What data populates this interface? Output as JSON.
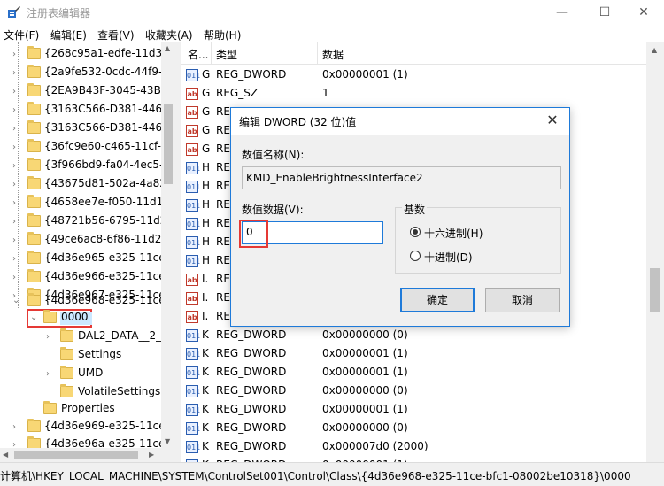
{
  "window": {
    "title": "注册表编辑器",
    "minimize": "—",
    "maximize": "☐",
    "close": "✕"
  },
  "menu": [
    "文件(F)",
    "编辑(E)",
    "查看(V)",
    "收藏夹(A)",
    "帮助(H)"
  ],
  "tree": {
    "keys": [
      "{268c95a1-edfe-11d3-9",
      "{2a9fe532-0cdc-44f9-9",
      "{2EA9B43F-3045-43B5-",
      "{3163C566-D381-4467-",
      "{3163C566-D381-4467-",
      "{36fc9e60-c465-11cf-80",
      "{3f966bd9-fa04-4ec5-9",
      "{43675d81-502a-4a82-",
      "{4658ee7e-f050-11d1-b",
      "{48721b56-6795-11d2-",
      "{49ce6ac8-6f86-11d2-b",
      "{4d36e965-e325-11ce-",
      "{4d36e966-e325-11ce-",
      "{4d36e967-e325-11ce-",
      "{4d36e968-e325-11ce-"
    ],
    "selected": "0000",
    "children": [
      "DAL2_DATA__2_0",
      "Settings",
      "UMD",
      "VolatileSettings"
    ],
    "properties": "Properties",
    "after": [
      "{4d36e969-e325-11ce-",
      "{4d36e96a-e325-11ce-"
    ]
  },
  "list": {
    "headers": {
      "name": "名...",
      "type": "类型",
      "data": "数据"
    },
    "rows": [
      {
        "icon": "bin",
        "name": "G",
        "type": "REG_DWORD",
        "data": "0x00000001 (1)"
      },
      {
        "icon": "ab",
        "name": "G",
        "type": "REG_SZ",
        "data": "1"
      },
      {
        "icon": "ab",
        "name": "G",
        "type": "RE",
        "data": ""
      },
      {
        "icon": "ab",
        "name": "G",
        "type": "RE",
        "data": ""
      },
      {
        "icon": "ab",
        "name": "G",
        "type": "RE",
        "data": ""
      },
      {
        "icon": "bin",
        "name": "H",
        "type": "RE",
        "data": ""
      },
      {
        "icon": "bin",
        "name": "H",
        "type": "RE",
        "data": ""
      },
      {
        "icon": "bin",
        "name": "H",
        "type": "RE",
        "data": ""
      },
      {
        "icon": "bin",
        "name": "H",
        "type": "RE",
        "data": ""
      },
      {
        "icon": "bin",
        "name": "H",
        "type": "RE",
        "data": ""
      },
      {
        "icon": "bin",
        "name": "H",
        "type": "RE",
        "data": ""
      },
      {
        "icon": "ab",
        "name": "I.",
        "type": "RE",
        "data": ""
      },
      {
        "icon": "ab",
        "name": "I.",
        "type": "RE",
        "data": ""
      },
      {
        "icon": "ab",
        "name": "I.",
        "type": "RE",
        "data": ""
      },
      {
        "icon": "bin",
        "name": "K",
        "type": "REG_DWORD",
        "data": "0x00000000 (0)"
      },
      {
        "icon": "bin",
        "name": "K",
        "type": "REG_DWORD",
        "data": "0x00000001 (1)"
      },
      {
        "icon": "bin",
        "name": "K",
        "type": "REG_DWORD",
        "data": "0x00000001 (1)"
      },
      {
        "icon": "bin",
        "name": "K",
        "type": "REG_DWORD",
        "data": "0x00000000 (0)"
      },
      {
        "icon": "bin",
        "name": "K",
        "type": "REG_DWORD",
        "data": "0x00000001 (1)"
      },
      {
        "icon": "bin",
        "name": "K",
        "type": "REG_DWORD",
        "data": "0x00000000 (0)"
      },
      {
        "icon": "bin",
        "name": "K",
        "type": "REG_DWORD",
        "data": "0x000007d0 (2000)"
      },
      {
        "icon": "bin",
        "name": "K",
        "type": "REG_DWORD",
        "data": "0x00000001 (1)"
      }
    ]
  },
  "status": "计算机\\HKEY_LOCAL_MACHINE\\SYSTEM\\ControlSet001\\Control\\Class\\{4d36e968-e325-11ce-bfc1-08002be10318}\\0000",
  "dialog": {
    "title": "编辑 DWORD (32 位)值",
    "name_label": "数值名称(N):",
    "name_value": "KMD_EnableBrightnessInterface2",
    "data_label": "数值数据(V):",
    "data_value": "0",
    "base_label": "基数",
    "hex_label": "十六进制(H)",
    "dec_label": "十进制(D)",
    "hex_selected": true,
    "ok": "确定",
    "cancel": "取消",
    "close": "✕"
  },
  "colors": {
    "accent": "#1e7ad9",
    "highlight": "#e53935",
    "folder": "#f8d775"
  }
}
